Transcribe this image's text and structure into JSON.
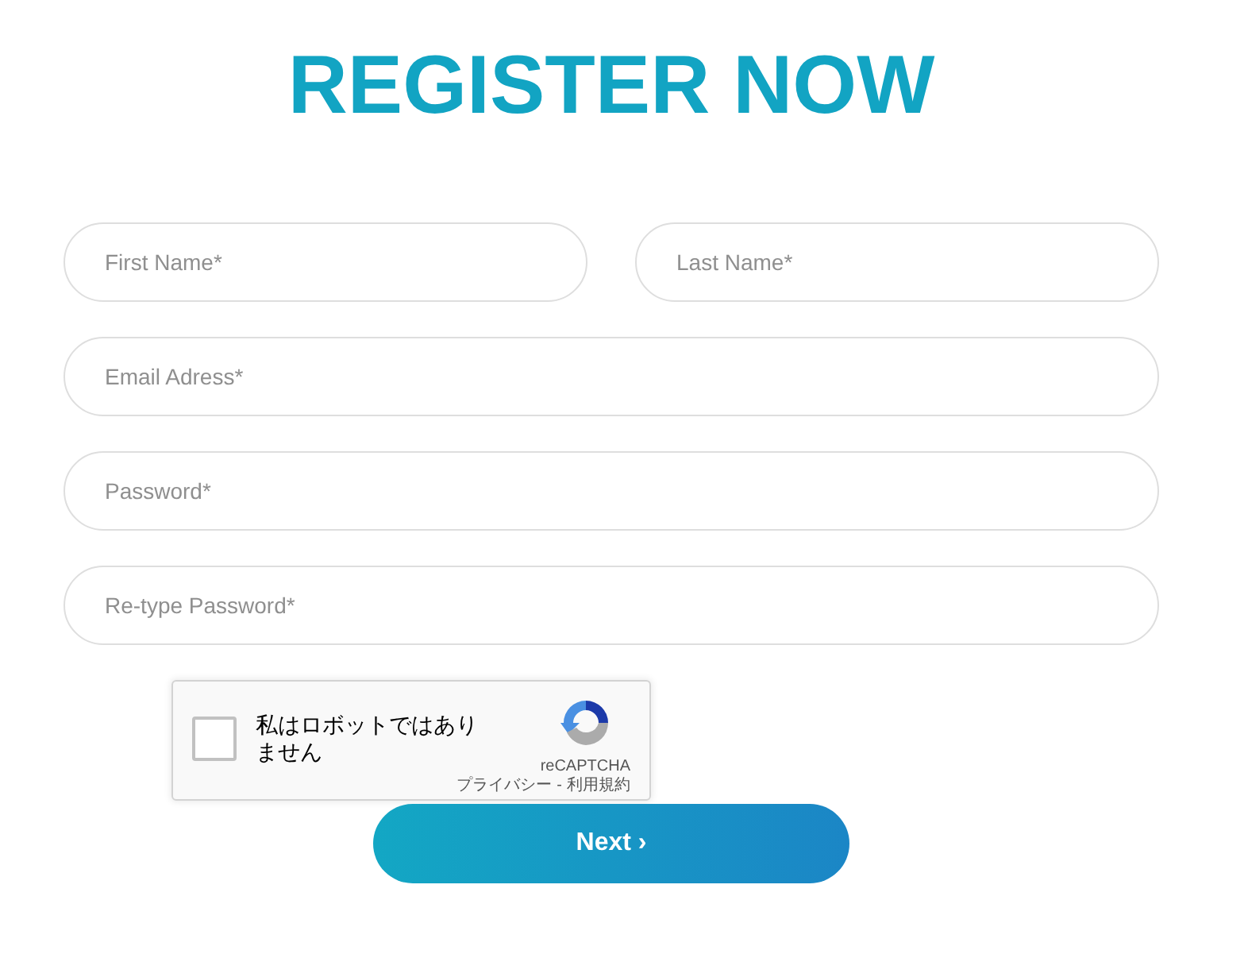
{
  "title": "REGISTER NOW",
  "field_rows": [
    {
      "fields": [
        {
          "placeholder": "First Name*"
        },
        {
          "placeholder": "Last Name*"
        }
      ]
    },
    {
      "fields": [
        {
          "placeholder": "Email Adress*"
        }
      ]
    },
    {
      "fields": [
        {
          "placeholder": "Password*"
        }
      ]
    },
    {
      "fields": [
        {
          "placeholder": "Re-type Password*"
        }
      ]
    }
  ],
  "captcha": {
    "checked": false,
    "label": "私はロボットではありません",
    "brand": "reCAPTCHA",
    "links": [
      "プライバシー",
      "利用規約"
    ],
    "separator": "-"
  },
  "next_button": {
    "label": "Next ›"
  }
}
